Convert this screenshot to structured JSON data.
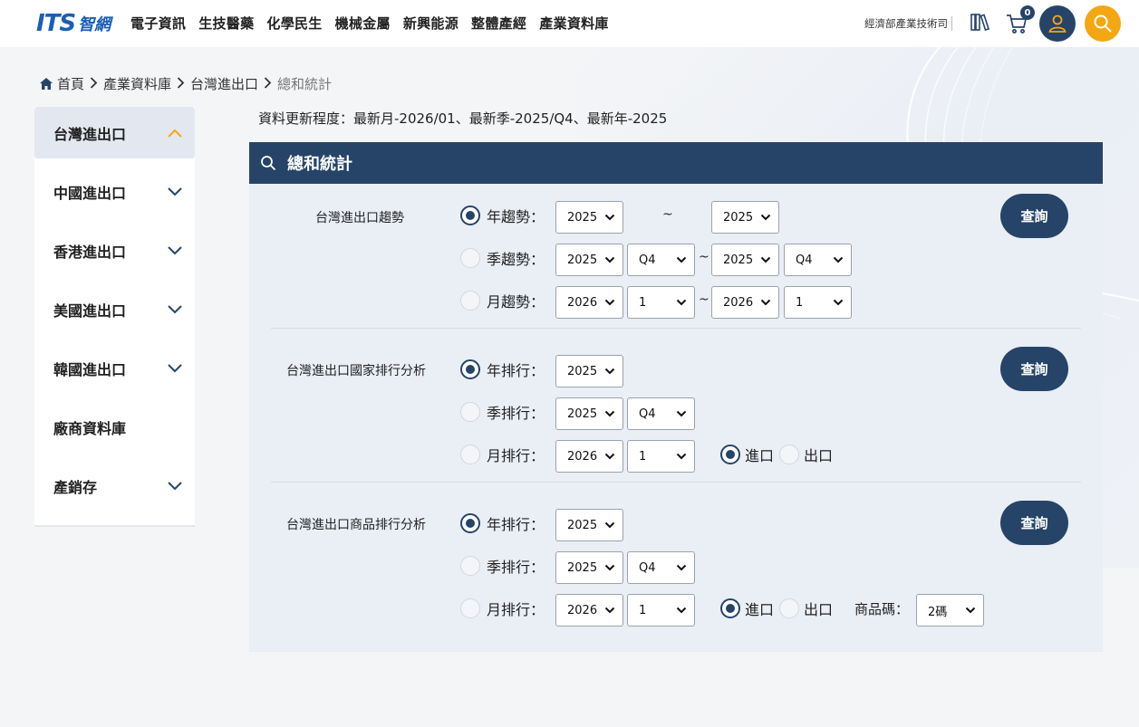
{
  "header": {
    "logo_its": "ITS",
    "logo_cn": "智網",
    "nav": [
      "電子資訊",
      "生技醫藥",
      "化學民生",
      "機械金屬",
      "新興能源",
      "整體產經",
      "產業資料庫"
    ],
    "moea_text": "經濟部產業技術司",
    "cart_count": "0"
  },
  "breadcrumb": {
    "items": [
      "首頁",
      "產業資料庫",
      "台灣進出口",
      "總和統計"
    ]
  },
  "sidebar": {
    "items": [
      {
        "label": "台灣進出口",
        "expanded": true
      },
      {
        "label": "中國進出口"
      },
      {
        "label": "香港進出口"
      },
      {
        "label": "美國進出口"
      },
      {
        "label": "韓國進出口"
      },
      {
        "label": "廠商資料庫"
      },
      {
        "label": "產銷存"
      }
    ]
  },
  "main": {
    "update_text": "資料更新程度：最新月-2026/01、最新季-2025/Q4、最新年-2025",
    "panel_title": "總和統計",
    "query_label": "查詢",
    "tilde": "~",
    "section1": {
      "title": "台灣進出口趨勢",
      "year_label": "年趨勢：",
      "season_label": "季趨勢：",
      "month_label": "月趨勢：",
      "year_from": "2025",
      "year_to": "2025",
      "season_from_year": "2025",
      "season_from_q": "Q4",
      "season_to_year": "2025",
      "season_to_q": "Q4",
      "month_from_year": "2026",
      "month_from_m": "1",
      "month_to_year": "2026",
      "month_to_m": "1"
    },
    "section2": {
      "title": "台灣進出口國家排行分析",
      "year_label": "年排行：",
      "season_label": "季排行：",
      "month_label": "月排行：",
      "year": "2025",
      "season_year": "2025",
      "season_q": "Q4",
      "month_year": "2026",
      "month_m": "1",
      "import_label": "進口",
      "export_label": "出口"
    },
    "section3": {
      "title": "台灣進出口商品排行分析",
      "year_label": "年排行：",
      "season_label": "季排行：",
      "month_label": "月排行：",
      "year": "2025",
      "season_year": "2025",
      "season_q": "Q4",
      "month_year": "2026",
      "month_m": "1",
      "import_label": "進口",
      "export_label": "出口",
      "code_label": "商品碼：",
      "code_value": "2碼"
    }
  },
  "colors": {
    "primary": "#264468",
    "accent": "#f5a712",
    "logo": "#1a5fb4",
    "panel_bg": "#eaeef5"
  }
}
